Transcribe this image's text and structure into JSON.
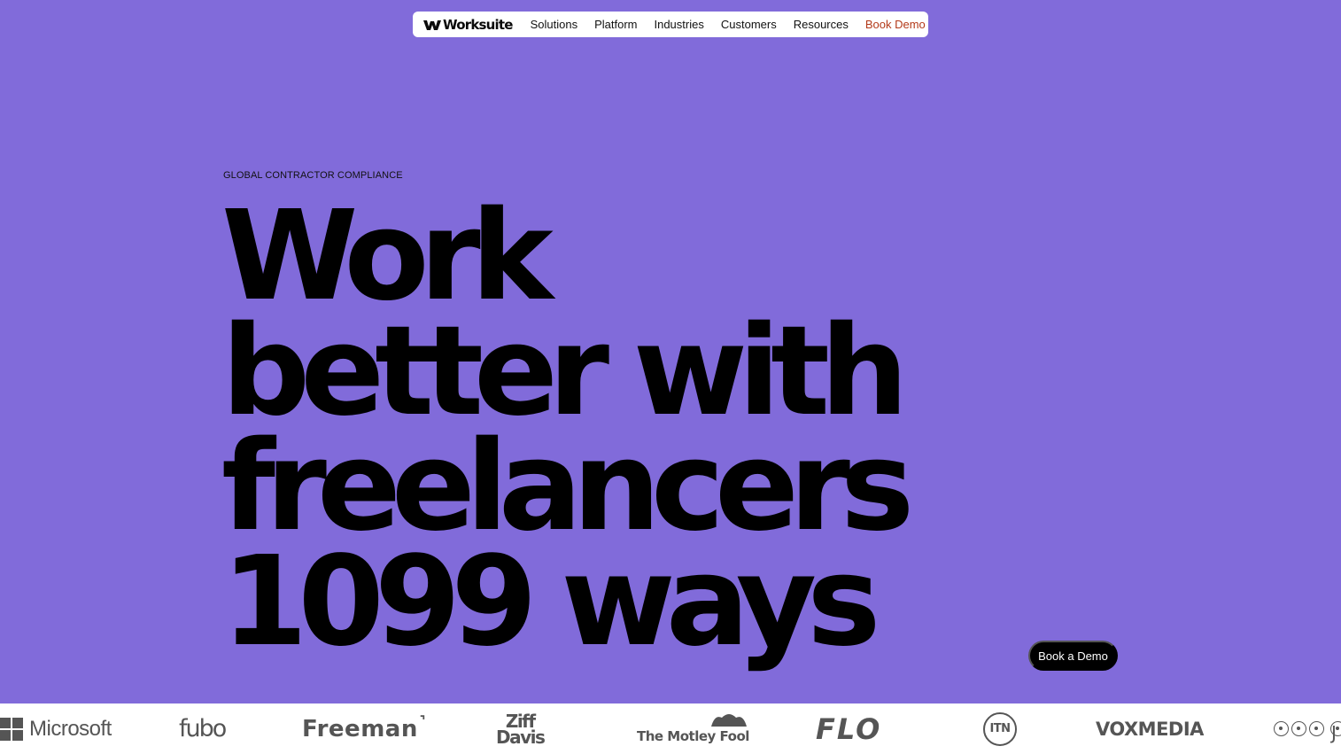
{
  "nav": {
    "logo_text": "Worksuite",
    "links": [
      "Solutions",
      "Platform",
      "Industries",
      "Customers",
      "Resources"
    ],
    "cta": "Book Demo"
  },
  "hero": {
    "eyebrow": "GLOBAL CONTRACTOR COMPLIANCE",
    "headline_lines": [
      "Work",
      "better with",
      "freelancers",
      "1099 ways"
    ]
  },
  "float_button": "Book a Demo",
  "logos": {
    "microsoft": "Microsoft",
    "fubo": "fubo",
    "freeman": "Freeman",
    "ziff_line1": "Ziff",
    "ziff_line2": "Davis",
    "motley": "The Motley Fool",
    "flo": "FLO",
    "itn": "ITN",
    "vox": "VOXMEDIA",
    "partial": "J"
  },
  "colors": {
    "background": "#816bda",
    "cta_link": "#b33a1a"
  }
}
